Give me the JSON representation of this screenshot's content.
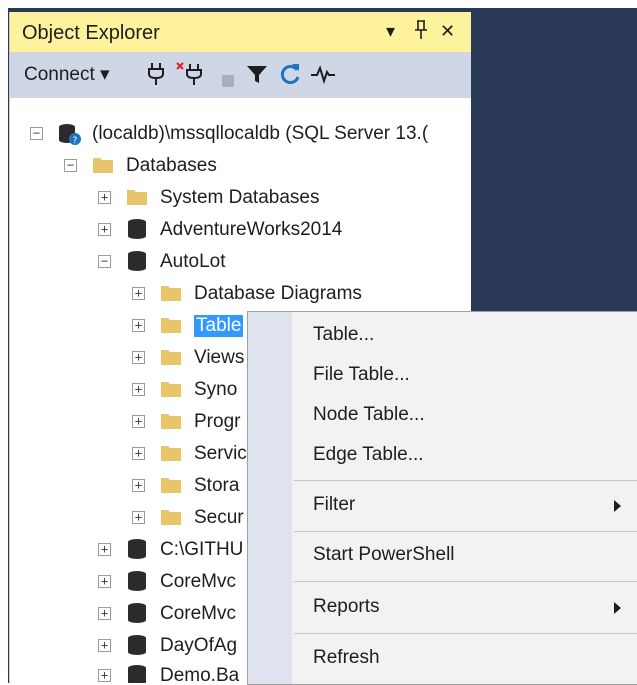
{
  "panel": {
    "title": "Object Explorer",
    "title_buttons": {
      "dropdown": "▾",
      "pin": "ᵖ",
      "close": "✕"
    },
    "connect_label": "Connect ▾"
  },
  "colors": {
    "title_bg": "#fff29d",
    "toolbar_bg": "#cfd6e5",
    "background_dark": "#293955",
    "selection": "#3399ff",
    "menu_bg": "#f2f2f2",
    "menu_gutter": "#dfe3ef",
    "refresh_icon": "#1e73be"
  },
  "tree": {
    "server": "(localdb)\\mssqllocaldb (SQL Server 13.(",
    "databases": "Databases",
    "system_databases": "System Databases",
    "db_adventureworks": "AdventureWorks2014",
    "db_autolot": "AutoLot",
    "folder_diagrams": "Database Diagrams",
    "folder_tables": "Table",
    "folder_views": "Views",
    "folder_synonyms": "Syno",
    "folder_programmability": "Progr",
    "folder_service": "Servic",
    "folder_storage": "Stora",
    "folder_security": "Secur",
    "db_github": "C:\\GITHU",
    "db_coremvc1": "CoreMvc",
    "db_coremvc2": "CoreMvc",
    "db_dayofag": "DayOfAg",
    "db_demo": "Demo.Ba"
  },
  "menu": {
    "items": [
      {
        "label": "Table...",
        "has_submenu": false
      },
      {
        "label": "File Table...",
        "has_submenu": false
      },
      {
        "label": "Node Table...",
        "has_submenu": false
      },
      {
        "label": "Edge Table...",
        "has_submenu": false
      },
      {
        "label": "Filter",
        "has_submenu": true
      },
      {
        "label": "Start PowerShell",
        "has_submenu": false
      },
      {
        "label": "Reports",
        "has_submenu": true
      },
      {
        "label": "Refresh",
        "has_submenu": false
      }
    ]
  }
}
